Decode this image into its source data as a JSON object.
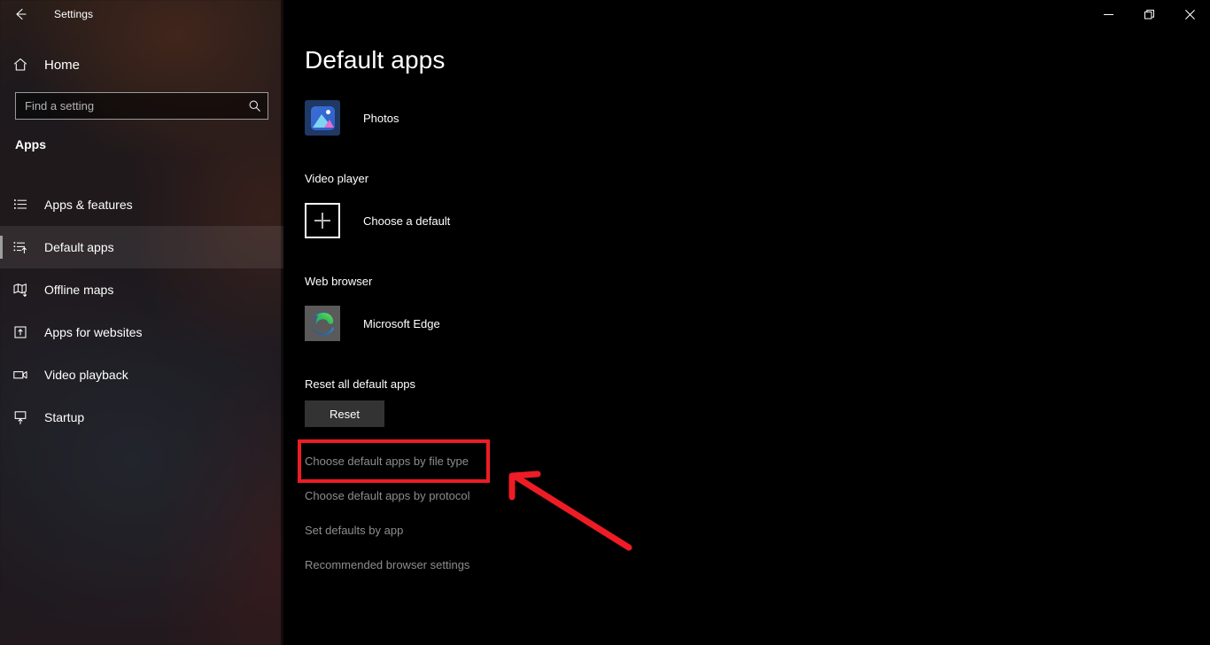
{
  "window": {
    "title": "Settings",
    "back_icon": "back-arrow-icon",
    "controls": {
      "minimize": "minimize-icon",
      "restore": "restore-icon",
      "close": "close-icon"
    }
  },
  "sidebar": {
    "home": {
      "label": "Home",
      "icon": "home-icon"
    },
    "search": {
      "value": "",
      "placeholder": "Find a setting",
      "icon": "search-icon"
    },
    "heading": "Apps",
    "items": [
      {
        "label": "Apps & features",
        "icon": "list-icon",
        "selected": false
      },
      {
        "label": "Default apps",
        "icon": "list-arrow-icon",
        "selected": true
      },
      {
        "label": "Offline maps",
        "icon": "map-download-icon",
        "selected": false
      },
      {
        "label": "Apps for websites",
        "icon": "box-arrow-up-icon",
        "selected": false
      },
      {
        "label": "Video playback",
        "icon": "video-camera-icon",
        "selected": false
      },
      {
        "label": "Startup",
        "icon": "monitor-arrow-up-icon",
        "selected": false
      }
    ]
  },
  "main": {
    "title": "Default apps",
    "photo_viewer": {
      "app_name": "Photos",
      "icon": "photos-app-icon"
    },
    "video_player": {
      "group_label": "Video player",
      "app_name": "Choose a default",
      "icon": "plus-icon"
    },
    "web_browser": {
      "group_label": "Web browser",
      "app_name": "Microsoft Edge",
      "icon": "microsoft-edge-icon"
    },
    "reset": {
      "group_label": "Reset all default apps",
      "button_label": "Reset"
    },
    "links": [
      "Choose default apps by file type",
      "Choose default apps by protocol",
      "Set defaults by app",
      "Recommended browser settings"
    ]
  },
  "annotations": {
    "highlight_color": "#ee1c25",
    "highlight_target": "Choose default apps by file type",
    "arrow": "pointer-arrow"
  }
}
